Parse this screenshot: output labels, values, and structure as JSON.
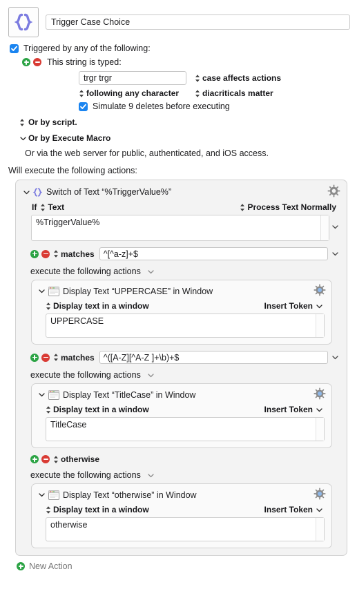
{
  "macro": {
    "icon_name": "braces-icon",
    "name": "Trigger Case Choice"
  },
  "trigger": {
    "enabled_label": "Triggered by any of the following:",
    "string_typed_label": "This string is typed:",
    "string_value": "trgr trgr",
    "case_option": "case affects actions",
    "following_option": "following any character",
    "diacriticals_option": "diacriticals matter",
    "simulate_label": "Simulate 9 deletes before executing",
    "or_script": "Or by script.",
    "or_execute_macro": "Or by Execute Macro",
    "web_server_note": "Or via the web server for public, authenticated, and iOS access."
  },
  "actions_intro": "Will execute the following actions:",
  "switch_action": {
    "title": "Switch of Text “%TriggerValue%”",
    "if_label": "If",
    "source_label": "Text",
    "process_label": "Process Text Normally",
    "source_value": "%TriggerValue%",
    "cases": [
      {
        "operator": "matches",
        "value": "^[^a-z]+$",
        "execute_label": "execute the following actions",
        "action": {
          "title": "Display Text “UPPERCASE” in Window",
          "mode": "Display text in a window",
          "insert_token": "Insert Token",
          "text": "UPPERCASE"
        }
      },
      {
        "operator": "matches",
        "value": "^([A-Z][^A-Z ]+\\b)+$",
        "execute_label": "execute the following actions",
        "action": {
          "title": "Display Text “TitleCase” in Window",
          "mode": "Display text in a window",
          "insert_token": "Insert Token",
          "text": "TitleCase"
        }
      },
      {
        "operator": "otherwise",
        "value": "",
        "execute_label": "execute the following actions",
        "action": {
          "title": "Display Text “otherwise” in Window",
          "mode": "Display text in a window",
          "insert_token": "Insert Token",
          "text": "otherwise"
        }
      }
    ]
  },
  "new_action_label": "New Action",
  "colors": {
    "accent_blue": "#1a84f0",
    "brace_purple": "#7b7be0",
    "add_green": "#2ba344",
    "remove_red": "#d93b34",
    "gear_blue": "#8fb8e8"
  }
}
